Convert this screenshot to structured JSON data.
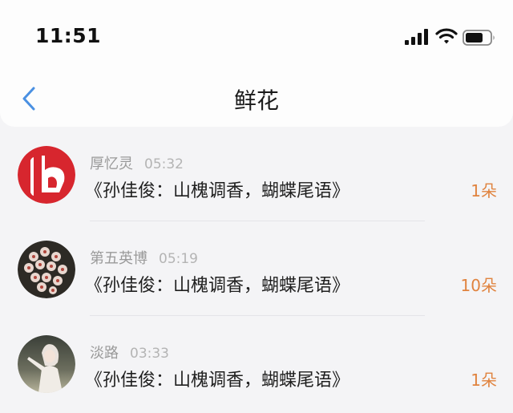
{
  "status_bar": {
    "time": "11:51",
    "icons": [
      "signal-icon",
      "wifi-icon",
      "battery-icon"
    ]
  },
  "nav": {
    "title": "鲜花",
    "back_icon": "chevron-left-icon",
    "accent_color": "#4a90e2"
  },
  "records": [
    {
      "user": "厚忆灵",
      "time": "05:32",
      "message": "《孙佳俊：山槐调香，蝴蝶尾语》",
      "count": "1朵",
      "avatar": "tv-logo-avatar"
    },
    {
      "user": "第五英博",
      "time": "05:19",
      "message": "《孙佳俊：山槐调香，蝴蝶尾语》",
      "count": "10朵",
      "avatar": "flower-photo-avatar"
    },
    {
      "user": "淡路",
      "time": "03:33",
      "message": "《孙佳俊：山槐调香，蝴蝶尾语》",
      "count": "1朵",
      "avatar": "person-photo-avatar"
    }
  ],
  "colors": {
    "count": "#e0833f",
    "meta": "#9a9a9a",
    "logo_red": "#d7262e"
  }
}
